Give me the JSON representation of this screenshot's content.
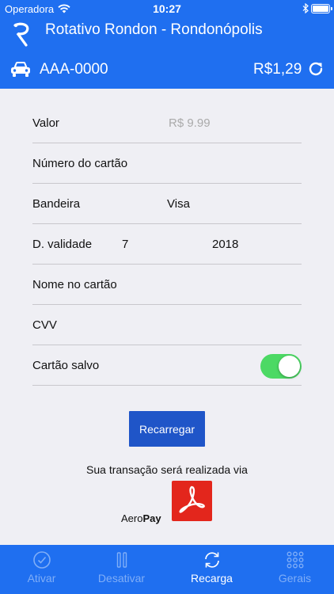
{
  "status_bar": {
    "carrier": "Operadora",
    "time": "10:27"
  },
  "header": {
    "title": "Rotativo Rondon - Rondonópolis",
    "plate": "AAA-0000",
    "balance": "R$1,29"
  },
  "form": {
    "valor_label": "Valor",
    "valor_placeholder": "R$ 9.99",
    "numero_label": "Número do cartão",
    "bandeira_label": "Bandeira",
    "bandeira_value": "Visa",
    "validade_label": "D. validade",
    "validade_month": "7",
    "validade_year": "2018",
    "nome_label": "Nome no cartão",
    "cvv_label": "CVV",
    "salvo_label": "Cartão salvo",
    "salvo_on": true
  },
  "actions": {
    "recarregar": "Recarregar"
  },
  "payment": {
    "via_text": "Sua transação será realizada via",
    "brand_prefix": "Aero",
    "brand_bold": "Pay"
  },
  "tabs": [
    {
      "label": "Ativar",
      "icon": "check-circle-icon"
    },
    {
      "label": "Desativar",
      "icon": "pause-icon"
    },
    {
      "label": "Recarga",
      "icon": "refresh-icon"
    },
    {
      "label": "Gerais",
      "icon": "grid-icon"
    }
  ],
  "colors": {
    "primary": "#1f6ff0",
    "button": "#1f55c8",
    "toggle_on": "#4cd964",
    "tab_inactive": "#80aef7"
  }
}
